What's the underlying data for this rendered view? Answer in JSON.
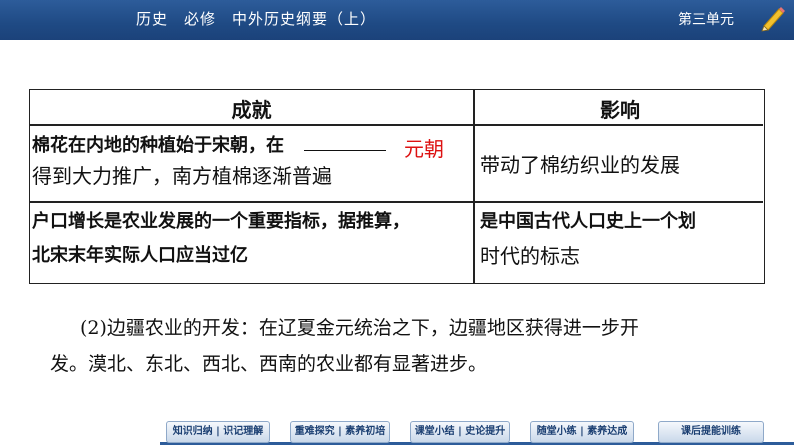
{
  "header": {
    "title": "历史　必修　中外历史纲要（上）",
    "unit": "第三单元"
  },
  "table": {
    "col1_header": "成就",
    "col2_header": "影响",
    "rows": [
      {
        "left_line1": "棉花在内地的种植始于宋朝，在",
        "left_answer": "元朝",
        "left_line2": "得到大力推广，南方植棉逐渐普遍",
        "right_line1": "带动了棉纺织业的发展"
      },
      {
        "left_line1": "户口增长是农业发展的一个重要指标，据推算，",
        "left_line2": "北宋末年实际人口应当过亿",
        "right_line1": "是中国古代人口史上一个划",
        "right_line2": "时代的标志"
      }
    ]
  },
  "paragraph": {
    "line1": "(2)边疆农业的开发：在辽夏金元统治之下，边疆地区获得进一步开",
    "line2": "发。漠北、东北、西北、西南的农业都有显著进步。"
  },
  "nav": {
    "items": [
      "知识归纳 | 识记理解",
      "重难探究 | 素养初培",
      "课堂小结 | 史论提升",
      "随堂小练 | 素养达成",
      "课后提能训练"
    ]
  },
  "colors": {
    "header_bg": "#1f4a84",
    "answer": "#dd1111"
  }
}
